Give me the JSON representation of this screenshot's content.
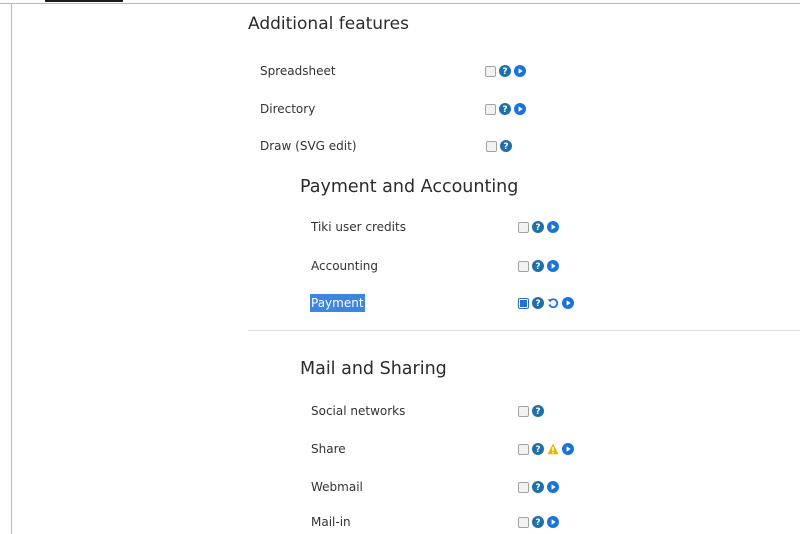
{
  "colors": {
    "help": "#1f6fa8",
    "play": "#1a73d9",
    "warning": "#f2b300",
    "selection": "#3d86e0"
  },
  "sections": {
    "additional": {
      "title": "Additional features"
    },
    "payment": {
      "title": "Payment and Accounting"
    },
    "mail": {
      "title": "Mail and Sharing"
    }
  },
  "features": [
    {
      "label": "Spreadsheet",
      "checked": false,
      "icons": [
        "help-icon",
        "play-icon"
      ]
    },
    {
      "label": "Directory",
      "checked": false,
      "icons": [
        "help-icon",
        "play-icon"
      ]
    },
    {
      "label": "Draw (SVG edit)",
      "checked": false,
      "icons": [
        "help-icon"
      ]
    },
    {
      "label": "Tiki user credits",
      "checked": false,
      "icons": [
        "help-icon",
        "play-icon"
      ]
    },
    {
      "label": "Accounting",
      "checked": false,
      "icons": [
        "help-icon",
        "play-icon"
      ]
    },
    {
      "label": "Payment",
      "checked": true,
      "selected": true,
      "icons": [
        "help-icon",
        "reset-icon",
        "play-icon"
      ]
    },
    {
      "label": "Social networks",
      "checked": false,
      "icons": [
        "help-icon"
      ]
    },
    {
      "label": "Share",
      "checked": false,
      "icons": [
        "help-icon",
        "warning-icon",
        "play-icon"
      ]
    },
    {
      "label": "Webmail",
      "checked": false,
      "icons": [
        "help-icon",
        "play-icon"
      ]
    },
    {
      "label": "Mail-in",
      "checked": false,
      "icons": [
        "help-icon",
        "play-icon"
      ]
    }
  ]
}
